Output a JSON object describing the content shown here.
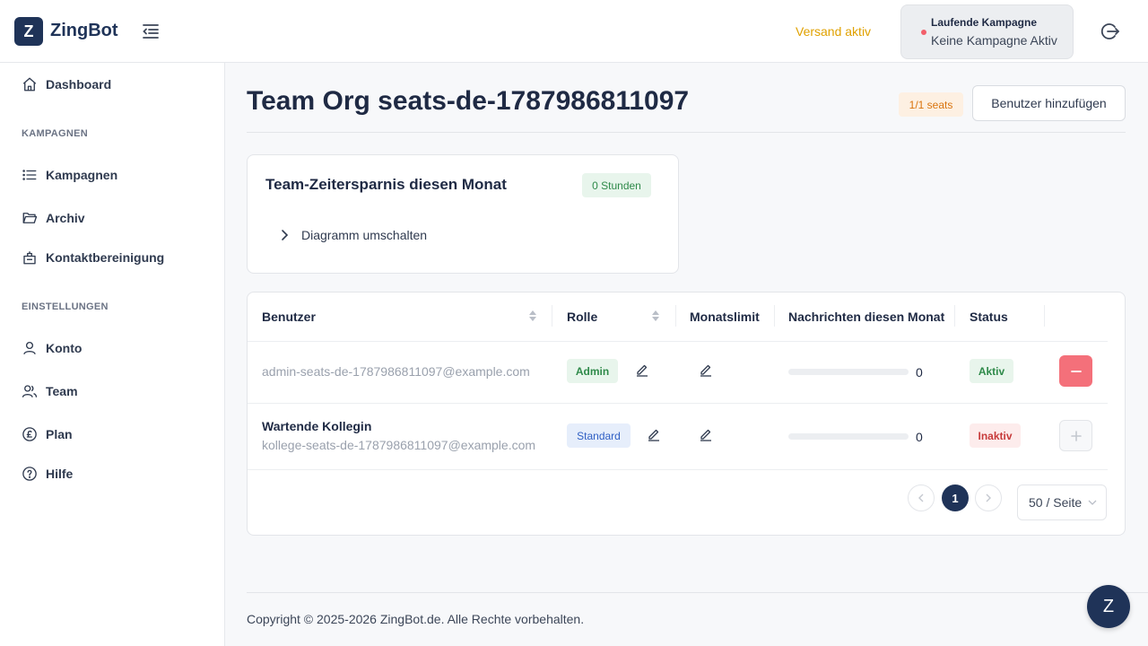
{
  "app": {
    "logo_letter": "Z",
    "name": "ZingBot"
  },
  "header": {
    "send_status": "Versand aktiv",
    "campaign_title": "Laufende Kampagne",
    "campaign_value": "Keine Kampagne Aktiv"
  },
  "sidebar": {
    "dashboard": "Dashboard",
    "section_campaigns": "KAMPAGNEN",
    "campaigns": "Kampagnen",
    "archive": "Archiv",
    "contact_cleanup": "Kontaktbereinigung",
    "section_settings": "EINSTELLUNGEN",
    "account": "Konto",
    "team": "Team",
    "plan": "Plan",
    "help": "Hilfe"
  },
  "main": {
    "title": "Team Org seats-de-1787986811097",
    "seats_badge": "1/1 seats",
    "add_user_label": "Benutzer hinzufügen",
    "savings_card": {
      "title": "Team-Zeitersparnis diesen Monat",
      "hours": "0 Stunden",
      "toggle_label": "Diagramm umschalten"
    }
  },
  "table": {
    "headers": {
      "user": "Benutzer",
      "role": "Rolle",
      "limit": "Monatslimit",
      "messages": "Nachrichten diesen Monat",
      "status": "Status"
    },
    "rows": [
      {
        "name": "",
        "email": "admin-seats-de-1787986811097@example.com",
        "role": "Admin",
        "messages": "0",
        "status": "Aktiv"
      },
      {
        "name": "Wartende Kollegin",
        "email": "kollege-seats-de-1787986811097@example.com",
        "role": "Standard",
        "messages": "0",
        "status": "Inaktiv"
      }
    ],
    "pagination": {
      "current": "1",
      "page_size": "50 / Seite"
    }
  },
  "footer": {
    "copyright": "Copyright © 2025-2026 ZingBot.de. Alle Rechte vorbehalten."
  },
  "chat": {
    "label": "Z"
  },
  "colors": {
    "brand": "#1f3358",
    "active_green": "#2f8a4a",
    "danger": "#f4707a",
    "warning": "#e0a100"
  }
}
